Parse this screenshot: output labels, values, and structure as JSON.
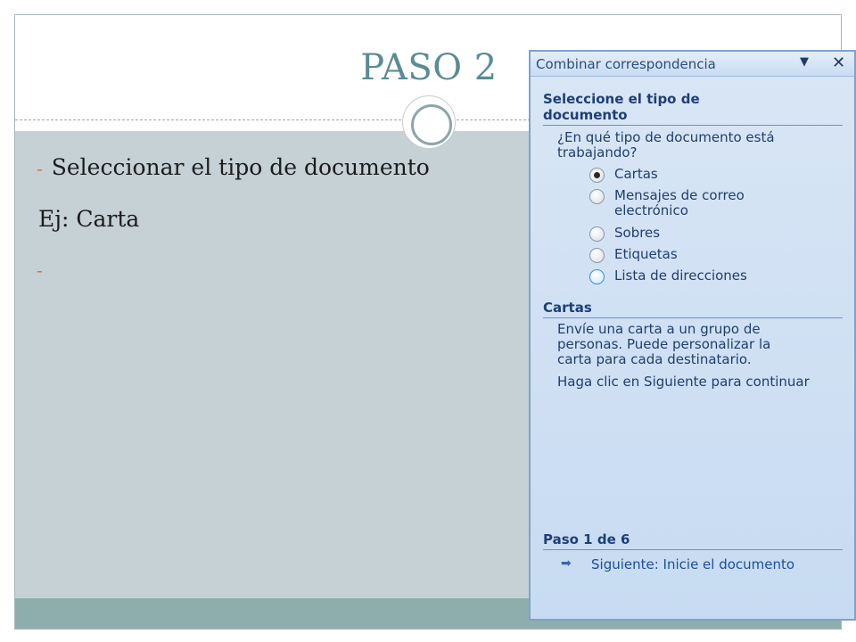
{
  "slide": {
    "title": "PASO 2",
    "bullet1": "Seleccionar el tipo de documento",
    "line2": "Ej: Carta",
    "dash": "-"
  },
  "task_pane": {
    "title": "Combinar correspondencia",
    "dropdown_icon": "▼",
    "close_icon": "✕",
    "section1_heading_line1": "Seleccione el tipo de",
    "section1_heading_line2": "documento",
    "question_line1": "¿En qué tipo de documento está",
    "question_line2": "trabajando?",
    "options": [
      {
        "label": "Cartas",
        "checked": true
      },
      {
        "label": "Mensajes de correo",
        "label2": "electrónico",
        "checked": false
      },
      {
        "label": "Sobres",
        "checked": false
      },
      {
        "label": "Etiquetas",
        "checked": false
      },
      {
        "label": "Lista de direcciones",
        "checked": false
      }
    ],
    "section2_heading": "Cartas",
    "desc_line1": "Envíe una carta a un grupo de",
    "desc_line2": "personas. Puede personalizar la",
    "desc_line3": "carta para cada destinatario.",
    "hint": "Haga clic en Siguiente para continuar",
    "step_heading": "Paso 1 de 6",
    "next_icon": "➡",
    "next_label": "Siguiente: Inicie el documento"
  },
  "colors": {
    "title": "#5b8c93",
    "content_bg": "#c6d1d6",
    "bottom_band": "#8eaeae",
    "pane_bg": "#d9e6f5",
    "dash": "#e2703a"
  }
}
